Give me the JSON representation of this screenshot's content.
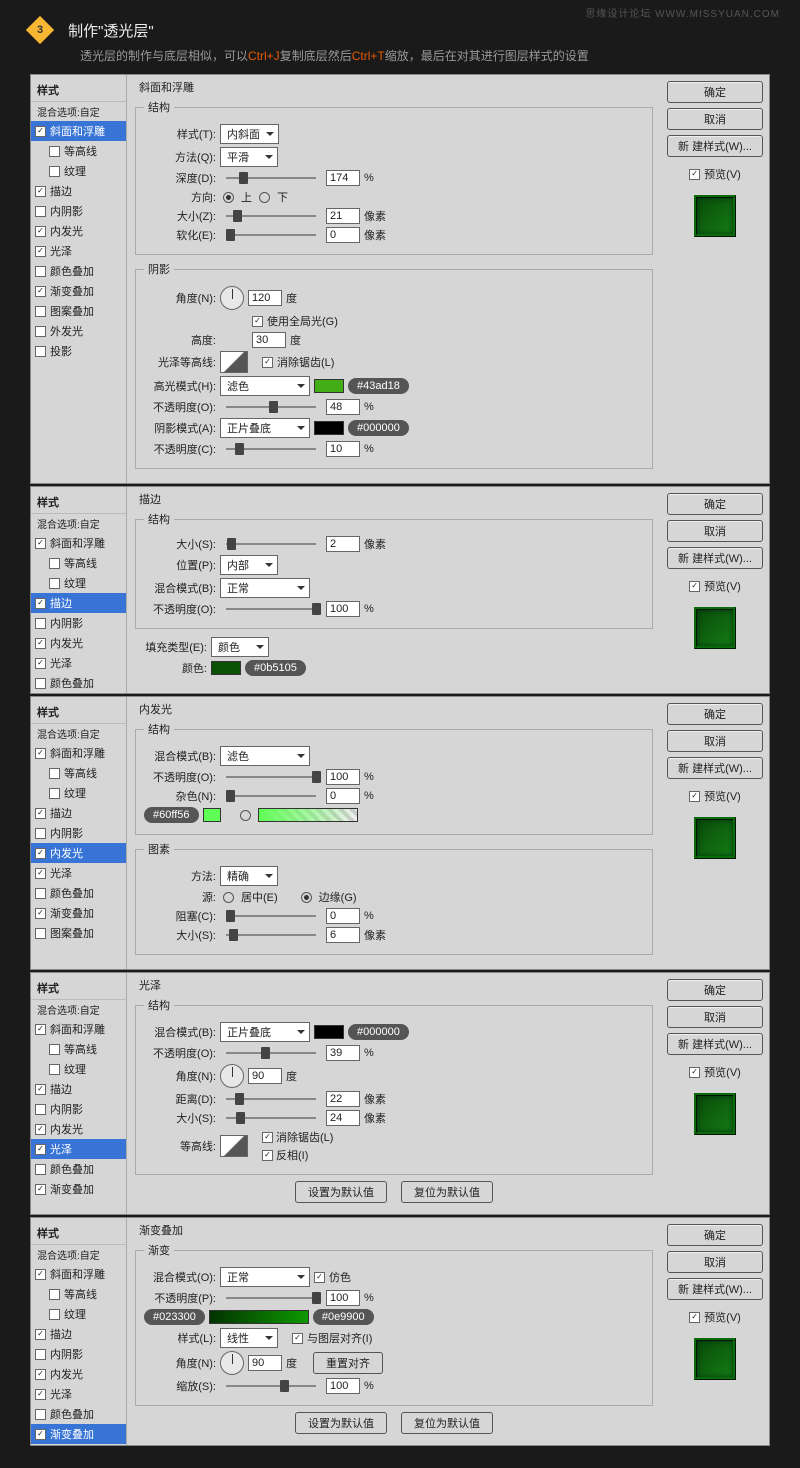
{
  "watermark": "思缘设计论坛  WWW.MISSYUAN.COM",
  "header": {
    "step": "3",
    "title": "制作\"透光层\"",
    "sub_a": "透光层的制作与底层相似，可以",
    "k1": "Ctrl+J",
    "sub_b": "复制底层然后",
    "k2": "Ctrl+T",
    "sub_c": "缩放，最后在对其进行图层样式的设置"
  },
  "right": {
    "ok": "确定",
    "cancel": "取消",
    "newstyle": "新 建样式(W)...",
    "preview": "预览(V)"
  },
  "common": {
    "style_head": "样式",
    "blend_opt": "混合选项:自定"
  },
  "side_items": {
    "bevel": "斜面和浮雕",
    "contour": "等高线",
    "texture": "纹理",
    "stroke": "描边",
    "innershadow": "内阴影",
    "innerglow": "内发光",
    "satin": "光泽",
    "coloroverlay": "颜色叠加",
    "gradoverlay": "渐变叠加",
    "patternoverlay": "图案叠加",
    "outerglow": "外发光",
    "dropshadow": "投影"
  },
  "p1": {
    "title": "斜面和浮雕",
    "fs_struct": "结构",
    "fs_shadow": "阴影",
    "style_l": "样式(T):",
    "style_v": "内斜面",
    "method_l": "方法(Q):",
    "method_v": "平滑",
    "depth_l": "深度(D):",
    "depth_v": "174",
    "pct": "%",
    "dir_l": "方向:",
    "up": "上",
    "down": "下",
    "size_l": "大小(Z):",
    "size_v": "21",
    "px": "像素",
    "soft_l": "软化(E):",
    "soft_v": "0",
    "angle_l": "角度(N):",
    "angle_v": "120",
    "deg": "度",
    "global": "使用全局光(G)",
    "alt_l": "高度:",
    "alt_v": "30",
    "gloss_l": "光泽等高线:",
    "aa": "消除锯齿(L)",
    "hlmode_l": "高光模式(H):",
    "hlmode_v": "滤色",
    "hlcolor": "#43ad18",
    "hlop_l": "不透明度(O):",
    "hlop_v": "48",
    "shmode_l": "阴影模式(A):",
    "shmode_v": "正片叠底",
    "shcolor": "#000000",
    "shop_l": "不透明度(C):",
    "shop_v": "10"
  },
  "p2": {
    "title": "描边",
    "fs": "结构",
    "size_l": "大小(S):",
    "size_v": "2",
    "px": "像素",
    "pos_l": "位置(P):",
    "pos_v": "内部",
    "blend_l": "混合模式(B):",
    "blend_v": "正常",
    "op_l": "不透明度(O):",
    "op_v": "100",
    "pct": "%",
    "filltype_l": "填充类型(E):",
    "filltype_v": "颜色",
    "color_l": "颜色:",
    "hex": "#0b5105"
  },
  "p3": {
    "title": "内发光",
    "fs_struct": "结构",
    "fs_elem": "图素",
    "blend_l": "混合模式(B):",
    "blend_v": "滤色",
    "op_l": "不透明度(O):",
    "op_v": "100",
    "pct": "%",
    "noise_l": "杂色(N):",
    "noise_v": "0",
    "hex": "#60ff56",
    "method_l": "方法:",
    "method_v": "精确",
    "source_l": "源:",
    "center": "居中(E)",
    "edge": "边缘(G)",
    "choke_l": "阻塞(C):",
    "choke_v": "0",
    "size_l": "大小(S):",
    "size_v": "6",
    "px": "像素"
  },
  "p4": {
    "title": "光泽",
    "fs": "结构",
    "blend_l": "混合模式(B):",
    "blend_v": "正片叠底",
    "hex": "#000000",
    "op_l": "不透明度(O):",
    "op_v": "39",
    "pct": "%",
    "angle_l": "角度(N):",
    "angle_v": "90",
    "deg": "度",
    "dist_l": "距离(D):",
    "dist_v": "22",
    "px": "像素",
    "size_l": "大小(S):",
    "size_v": "24",
    "contour_l": "等高线:",
    "aa": "消除锯齿(L)",
    "invert": "反相(I)",
    "setdefault": "设置为默认值",
    "resetdefault": "复位为默认值"
  },
  "p5": {
    "title": "渐变叠加",
    "fs": "渐变",
    "blend_l": "混合模式(O):",
    "blend_v": "正常",
    "dither": "仿色",
    "op_l": "不透明度(P):",
    "op_v": "100",
    "pct": "%",
    "hex1": "#023300",
    "hex2": "#0e9900",
    "style_l": "样式(L):",
    "style_v": "线性",
    "align": "与图层对齐(I)",
    "angle_l": "角度(N):",
    "angle_v": "90",
    "deg": "度",
    "resetalign": "重置对齐",
    "scale_l": "缩放(S):",
    "scale_v": "100",
    "setdefault": "设置为默认值",
    "resetdefault": "复位为默认值"
  }
}
